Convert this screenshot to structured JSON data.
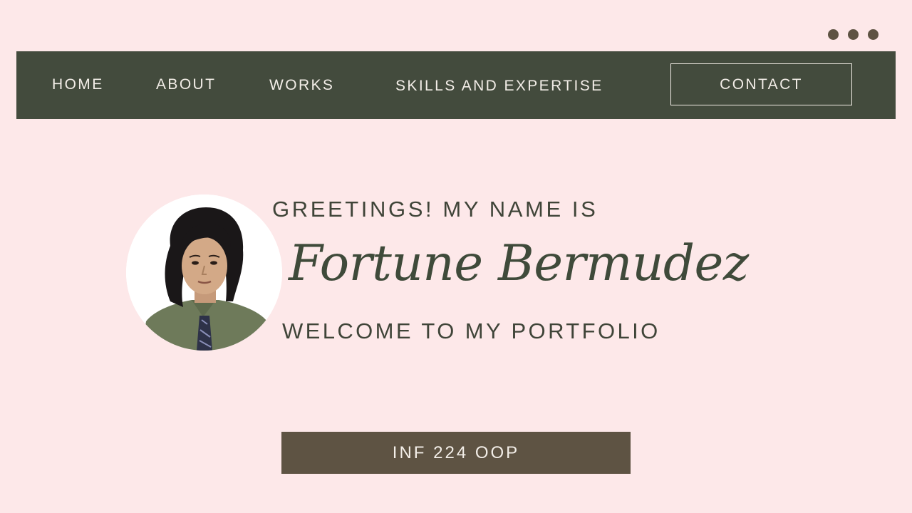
{
  "window_controls": {
    "icon": "more-dots-icon",
    "color": "#5e5343"
  },
  "nav": {
    "home_label": "HOME",
    "about_label": "ABOUT",
    "works_label": "WORKS",
    "skills_label": "SKILLS AND EXPERTISE",
    "contact_label": "CONTACT",
    "background_color": "#434b3d",
    "text_color": "#f3eee8"
  },
  "hero": {
    "greeting": "GREETINGS! MY NAME IS",
    "name": "Fortune Bermudez",
    "welcome": "WELCOME TO MY PORTFOLIO",
    "profile_photo": "profile-photo"
  },
  "course_button": {
    "label": "INF 224 OOP",
    "background_color": "#5e5343"
  },
  "colors": {
    "page_background": "#fde8e9",
    "heading_text": "#3f4a3a"
  }
}
